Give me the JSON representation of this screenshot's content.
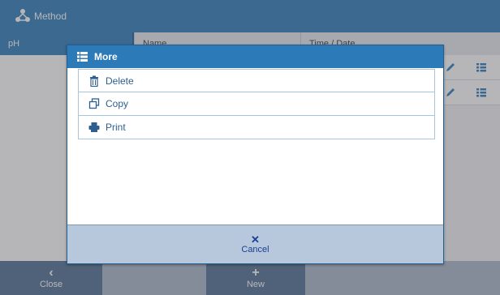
{
  "window": {
    "title": "Method",
    "logo_icon": "network-icon"
  },
  "sidebar": {
    "header": "pH"
  },
  "table": {
    "columns": [
      "Name",
      "Time / Date"
    ],
    "rows": [
      {
        "edit_icon": "pencil-icon",
        "detail_icon": "list-icon"
      },
      {
        "edit_icon": "pencil-icon",
        "detail_icon": "list-icon"
      }
    ]
  },
  "bottom_bar": {
    "close_label": "Close",
    "new_label": "New"
  },
  "dialog": {
    "title": "More",
    "title_icon": "list-icon",
    "items": [
      {
        "label": "Delete",
        "icon": "trash-icon"
      },
      {
        "label": "Copy",
        "icon": "copy-icon"
      },
      {
        "label": "Print",
        "icon": "printer-icon"
      }
    ],
    "cancel_label": "Cancel"
  },
  "colors": {
    "primary": "#2d7ab8",
    "bottom_bar": "#4f6f92",
    "cancel_text": "#1a3f96",
    "menu_text": "#2d5f8f"
  }
}
